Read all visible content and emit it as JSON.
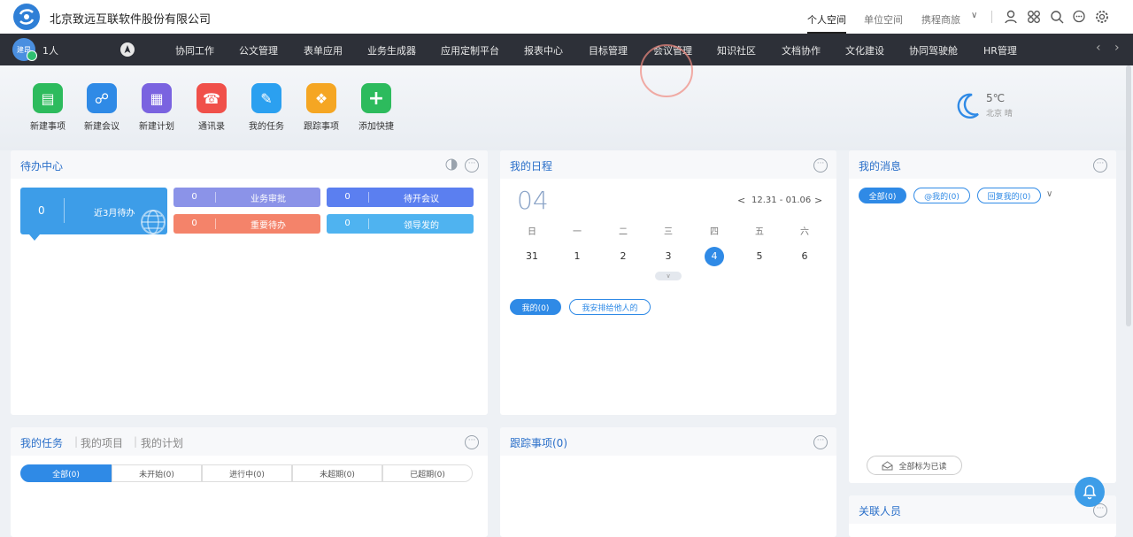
{
  "header": {
    "company": "北京致远互联软件股份有限公司",
    "spaces": [
      "个人空间",
      "单位空间",
      "携程商旅"
    ]
  },
  "nav": {
    "avatar_text": "建昂",
    "people": "1人",
    "items": [
      "协同工作",
      "公文管理",
      "表单应用",
      "业务生成器",
      "应用定制平台",
      "报表中心",
      "目标管理",
      "会议管理",
      "知识社区",
      "文档协作",
      "文化建设",
      "协同驾驶舱",
      "HR管理"
    ]
  },
  "quick": [
    {
      "label": "新建事项",
      "color": "#2dbb5d"
    },
    {
      "label": "新建会议",
      "color": "#2f8ae6"
    },
    {
      "label": "新建计划",
      "color": "#7a63e0"
    },
    {
      "label": "通讯录",
      "color": "#f0504a"
    },
    {
      "label": "我的任务",
      "color": "#2ba0f0"
    },
    {
      "label": "跟踪事项",
      "color": "#f5a623"
    },
    {
      "label": "添加快捷",
      "color": "#2dbb5d"
    }
  ],
  "weather": {
    "temp": "5℃",
    "city": "北京 晴"
  },
  "todo": {
    "title": "待办中心",
    "main_count": "0",
    "main_label": "近3月待办",
    "tiles": [
      {
        "count": "0",
        "label": "业务审批",
        "color": "#8b93e8"
      },
      {
        "count": "0",
        "label": "待开会议",
        "color": "#5b7ff0"
      },
      {
        "count": "0",
        "label": "重要待办",
        "color": "#f4836a"
      },
      {
        "count": "0",
        "label": "领导发的",
        "color": "#4fb3f0"
      }
    ]
  },
  "schedule": {
    "title": "我的日程",
    "day": "04",
    "range": "12.31 - 01.06",
    "weekdays": [
      "日",
      "一",
      "二",
      "三",
      "四",
      "五",
      "六"
    ],
    "dates": [
      "31",
      "1",
      "2",
      "3",
      "4",
      "5",
      "6"
    ],
    "today_index": 4,
    "pills": [
      "我的(0)",
      "我安排给他人的"
    ]
  },
  "messages": {
    "title": "我的消息",
    "pills": [
      "全部(0)",
      "@我的(0)",
      "回复我的(0)"
    ],
    "mark_read": "全部标为已读"
  },
  "tasks": {
    "tabs": [
      "我的任务",
      "我的项目",
      "我的计划"
    ],
    "segments": [
      "全部(0)",
      "未开始(0)",
      "进行中(0)",
      "未超期(0)",
      "已超期(0)"
    ]
  },
  "tracking": {
    "title": "跟踪事项(0)"
  },
  "related": {
    "title": "关联人员"
  }
}
